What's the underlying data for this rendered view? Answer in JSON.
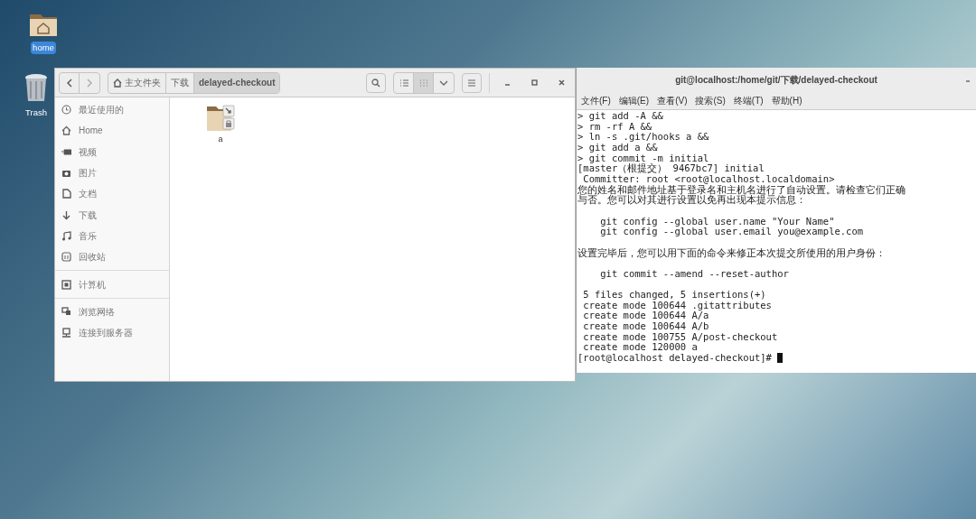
{
  "desktop_icons": [
    {
      "label": "home",
      "selected": true
    },
    {
      "label": "Trash",
      "selected": false
    }
  ],
  "file_manager": {
    "path": [
      {
        "label": "主文件夹",
        "selected": false
      },
      {
        "label": "下载",
        "selected": false
      },
      {
        "label": "delayed-checkout",
        "selected": true
      }
    ],
    "view_buttons": [
      {
        "selected": false
      },
      {
        "selected": true
      }
    ],
    "sidebar_sections": [
      [
        {
          "label": "最近使用的"
        },
        {
          "label": "Home"
        },
        {
          "label": "视频"
        },
        {
          "label": "图片"
        },
        {
          "label": "文档"
        },
        {
          "label": "下载"
        },
        {
          "label": "音乐"
        },
        {
          "label": "回收站"
        }
      ],
      [
        {
          "label": "计算机"
        }
      ],
      [
        {
          "label": "浏览网络"
        },
        {
          "label": "连接到服务器"
        }
      ]
    ],
    "files": [
      {
        "name": "a"
      }
    ]
  },
  "terminal": {
    "title": "git@localhost:/home/git/下载/delayed-checkout",
    "menu": [
      "文件(F)",
      "编辑(E)",
      "查看(V)",
      "搜索(S)",
      "终端(T)",
      "帮助(H)"
    ],
    "lines": [
      {
        "text": "> git add -A &&"
      },
      {
        "text": "> rm -rf A &&"
      },
      {
        "text": "> ln -s .git/hooks a &&"
      },
      {
        "text": "> git add a &&"
      },
      {
        "text": "> git commit -m initial"
      },
      {
        "text": "[master（根提交） 9467bc7] initial"
      },
      {
        "text": " Committer: root <root@localhost.localdomain>"
      },
      {
        "text": "您的姓名和邮件地址基于登录名和主机名进行了自动设置。请检查它们正确"
      },
      {
        "text": "与否。您可以对其进行设置以免再出现本提示信息："
      },
      {
        "kind": "blank"
      },
      {
        "text": "    git config --global user.name \"Your Name\""
      },
      {
        "text": "    git config --global user.email you@example.com"
      },
      {
        "kind": "blank"
      },
      {
        "text": "设置完毕后，您可以用下面的命令来修正本次提交所使用的用户身份："
      },
      {
        "kind": "blank"
      },
      {
        "text": "    git commit --amend --reset-author"
      },
      {
        "kind": "blank"
      },
      {
        "text": " 5 files changed, 5 insertions(+)"
      },
      {
        "text": " create mode 100644 .gitattributes"
      },
      {
        "text": " create mode 100644 A/a"
      },
      {
        "text": " create mode 100644 A/b"
      },
      {
        "text": " create mode 100755 A/post-checkout"
      },
      {
        "text": " create mode 120000 a"
      }
    ],
    "prompt": "[root@localhost delayed-checkout]# "
  }
}
